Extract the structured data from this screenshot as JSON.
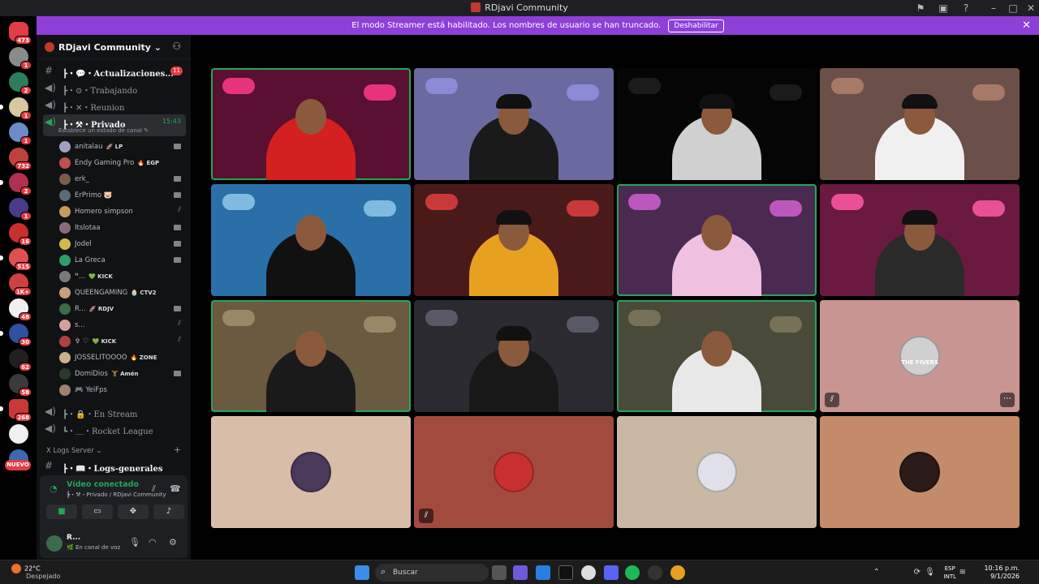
{
  "window": {
    "title": "RDjavi Community"
  },
  "banner": {
    "text": "El modo Streamer está habilitado. Los nombres de usuario se han truncado.",
    "button": "Deshabilitar"
  },
  "rail": {
    "badges": [
      "473",
      "1",
      "2",
      "1",
      "1",
      "732",
      "2",
      "1",
      "16",
      "515",
      "1K+",
      "48",
      "30",
      "62",
      "58",
      "268"
    ],
    "new_label": "NUEVO"
  },
  "server": {
    "name": "RDjavi Community ⌄"
  },
  "channels": {
    "actualizaciones": {
      "label": "┣・💬・Actualizaciones...",
      "count": "11"
    },
    "trabajando": {
      "label": "┣・⊙・Trabajando"
    },
    "reunion": {
      "label": "┣・✕・Reunion"
    },
    "privado": {
      "label": "┣・⚒・Privado",
      "time": "15:43",
      "status": "Establece un estado de canal ✎"
    },
    "en_stream": {
      "label": "┣・🔒・En Stream"
    },
    "rocket": {
      "label": "┗・＿・Rocket League"
    },
    "logs_category": "X Logs Server ⌄",
    "logs_generales": {
      "label": "┣・📖・Logs-generales"
    }
  },
  "members": [
    {
      "name": "anitalau",
      "tag": "🚀 LP",
      "icon": "video",
      "color": "#a0a0c0"
    },
    {
      "name": "Endy Gaming Pro",
      "tag": "🔥 EGP",
      "icon": "none",
      "color": "#c0504d"
    },
    {
      "name": "erk_",
      "tag": "",
      "icon": "video-live",
      "color": "#7a5c4a"
    },
    {
      "name": "ErPrimo 🐷",
      "tag": "",
      "icon": "video",
      "color": "#5c6b7a"
    },
    {
      "name": "Homero simpson",
      "tag": "",
      "icon": "mute",
      "color": "#c89b5a"
    },
    {
      "name": "Itslotaa",
      "tag": "",
      "icon": "video",
      "color": "#8a6a7a"
    },
    {
      "name": "Jodel",
      "tag": "",
      "icon": "video",
      "color": "#d4b84a"
    },
    {
      "name": "La Greca",
      "tag": "",
      "icon": "video",
      "color": "#2e9e6a"
    },
    {
      "name": "ꟸ...",
      "tag": "💚 KICK",
      "icon": "none",
      "color": "#7a7a7a"
    },
    {
      "name": "QUEENGAMING",
      "tag": "🧁 CTV2",
      "icon": "none",
      "color": "#c8a07a"
    },
    {
      "name": "R...",
      "tag": "🚀 RDJV",
      "icon": "video",
      "color": "#3a6b4a"
    },
    {
      "name": "s...",
      "tag": "",
      "icon": "mute",
      "color": "#d4a0a0"
    },
    {
      "name": "✞ ♡",
      "tag": "💚 KICK",
      "icon": "mute",
      "color": "#b04040"
    },
    {
      "name": "JOSSELITOOOO",
      "tag": "🔥 ZONE",
      "icon": "none",
      "color": "#c8b090"
    },
    {
      "name": "DomiDios",
      "tag": "🏋 Amén",
      "icon": "video",
      "color": "#2a3a2a"
    },
    {
      "name": "YeiFps",
      "tag": "",
      "icon": "none",
      "color": "#a08070",
      "prefix": "🎮"
    }
  ],
  "voice": {
    "status": "Vídeo conectado",
    "path": "┣・⚒・Privado / RDjavi Community"
  },
  "user": {
    "name": "R...",
    "status": "🌿 En canal de voz"
  },
  "taskbar": {
    "temp": "22°C",
    "weather": "Despejado",
    "search_placeholder": "Buscar",
    "lang": [
      "ESP",
      "INTL"
    ],
    "time": "10:16 p.m.",
    "date": "9/1/2026"
  },
  "tiles": [
    {
      "type": "cam",
      "bg": "#5a1030",
      "accent": "#ff3a8a",
      "shirt": "#d42020",
      "speaking": true
    },
    {
      "type": "cam",
      "bg": "#6a6aa0",
      "accent": "#8f8fe0",
      "shirt": "#1a1a1a",
      "speaking": false
    },
    {
      "type": "cam",
      "bg": "#050505",
      "accent": "#202020",
      "shirt": "#d0d0d0",
      "speaking": false
    },
    {
      "type": "cam",
      "bg": "#6a5048",
      "accent": "#b08070",
      "shirt": "#f0f0f0",
      "speaking": false
    },
    {
      "type": "cam",
      "bg": "#2a6fa8",
      "accent": "#8fc8e8",
      "shirt": "#111",
      "speaking": false
    },
    {
      "type": "cam",
      "bg": "#4a1a1a",
      "accent": "#e04040",
      "shirt": "#e8a020",
      "speaking": false
    },
    {
      "type": "cam",
      "bg": "#4a2a50",
      "accent": "#d060d0",
      "shirt": "#f0c0e0",
      "speaking": true
    },
    {
      "type": "cam",
      "bg": "#6a1a40",
      "accent": "#ff5aa8",
      "shirt": "#2a2a2a",
      "speaking": false
    },
    {
      "type": "cam",
      "bg": "#6a5a40",
      "accent": "#a09070",
      "shirt": "#1a1a1a",
      "speaking": true
    },
    {
      "type": "cam",
      "bg": "#2a2a30",
      "accent": "#606070",
      "shirt": "#181818",
      "speaking": false
    },
    {
      "type": "cam",
      "bg": "#4a4a3a",
      "accent": "#807860",
      "shirt": "#e8e8e8",
      "speaking": true
    },
    {
      "type": "avatar",
      "bg": "#c99590",
      "avatar": "#d0d0d0",
      "label": "THE FIVERS",
      "muted": true,
      "more": true
    },
    {
      "type": "avatar",
      "bg": "#d8bea8",
      "avatar": "#4a3a5a",
      "muted": false
    },
    {
      "type": "avatar",
      "bg": "#a34a3e",
      "avatar": "#c83030",
      "muted": true
    },
    {
      "type": "avatar",
      "bg": "#c9b9a4",
      "avatar": "#e0e0e8",
      "muted": false
    },
    {
      "type": "avatar",
      "bg": "#c48b6a",
      "avatar": "#2a1a1a",
      "muted": false
    }
  ]
}
